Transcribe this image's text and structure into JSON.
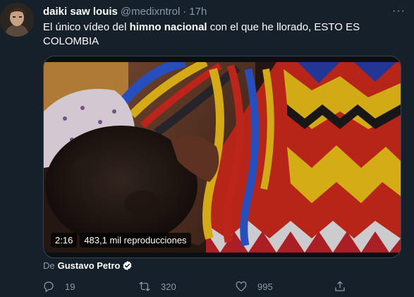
{
  "author": {
    "name": "daiki saw louis",
    "handle": "@medixntrol",
    "separator": "·",
    "time": "17h"
  },
  "tweet": {
    "text_before": "El único vídeo del ",
    "text_bold": "himno nacional",
    "text_after": " con el que he llorado, ESTO ES COLOMBIA"
  },
  "media": {
    "duration": "2:16",
    "views": "483,1 mil reproducciones"
  },
  "attribution": {
    "prefix": "De",
    "source": "Gustavo Petro"
  },
  "actions": {
    "reply_count": "19",
    "retweet_count": "320",
    "like_count": "995"
  },
  "icons": {
    "more": "more-icon",
    "verified": "verified-badge-icon",
    "reply": "reply-icon",
    "retweet": "retweet-icon",
    "like": "like-icon",
    "share": "share-icon"
  },
  "colors": {
    "background": "#15202b",
    "secondary_text": "#8b98a5",
    "border": "#38444d",
    "verified": "#ffffff"
  }
}
